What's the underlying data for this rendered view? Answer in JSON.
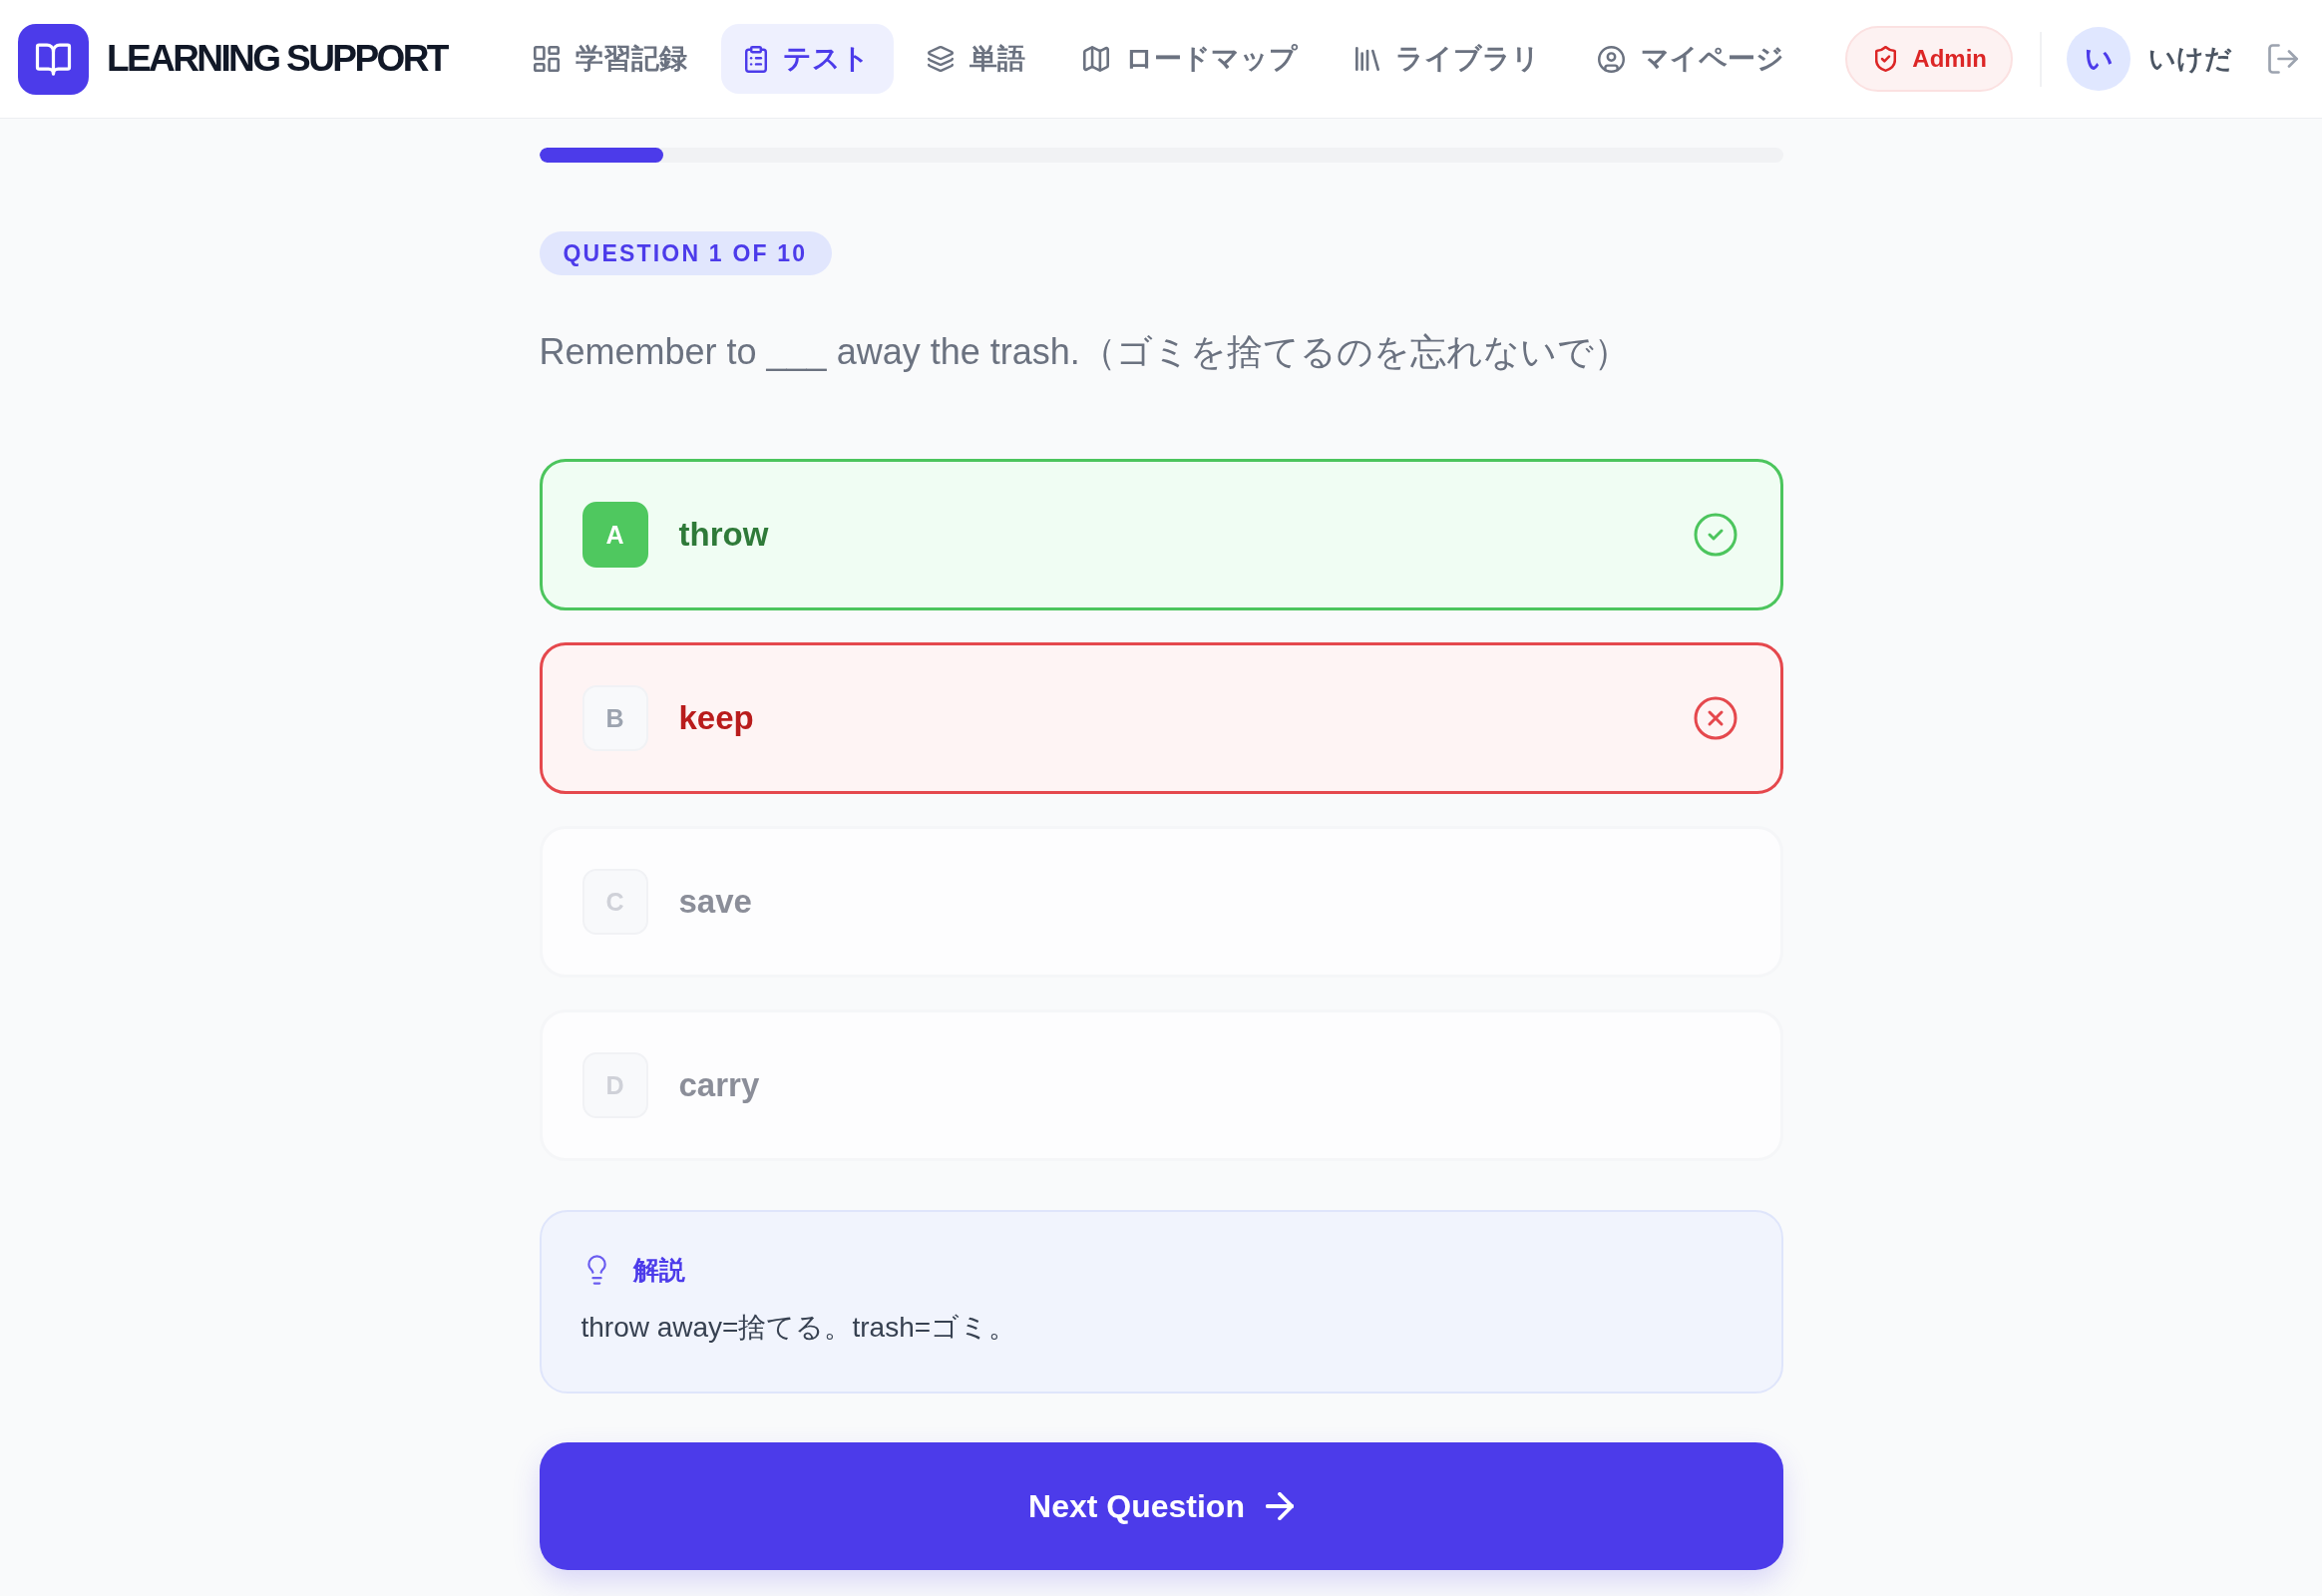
{
  "header": {
    "logo_title": "LEARNING SUPPORT",
    "nav": [
      {
        "label": "学習記録",
        "selected": false
      },
      {
        "label": "テスト",
        "selected": true
      },
      {
        "label": "単語",
        "selected": false
      },
      {
        "label": "ロードマップ",
        "selected": false
      },
      {
        "label": "ライブラリ",
        "selected": false
      },
      {
        "label": "マイページ",
        "selected": false
      }
    ],
    "admin_link": "Admin",
    "user": {
      "avatar_initial": "い",
      "name": "いけだ"
    }
  },
  "progress": {
    "level": 0.1
  },
  "question": {
    "counter": "QUESTION 1 OF 10",
    "text": "Remember to ___ away the trash.（ゴミを捨てるのを忘れないで）"
  },
  "options": [
    {
      "letter": "A",
      "text": "throw",
      "selected": false,
      "correct": true
    },
    {
      "letter": "B",
      "text": "keep",
      "selected": true,
      "correct": false
    },
    {
      "letter": "C",
      "text": "save",
      "selected": false,
      "correct": false
    },
    {
      "letter": "D",
      "text": "carry",
      "selected": false,
      "correct": false
    }
  ],
  "explanation": {
    "title": "解説",
    "text": "throw away=捨てる。trash=ゴミ。"
  },
  "next_button": {
    "label": "Next Question"
  }
}
